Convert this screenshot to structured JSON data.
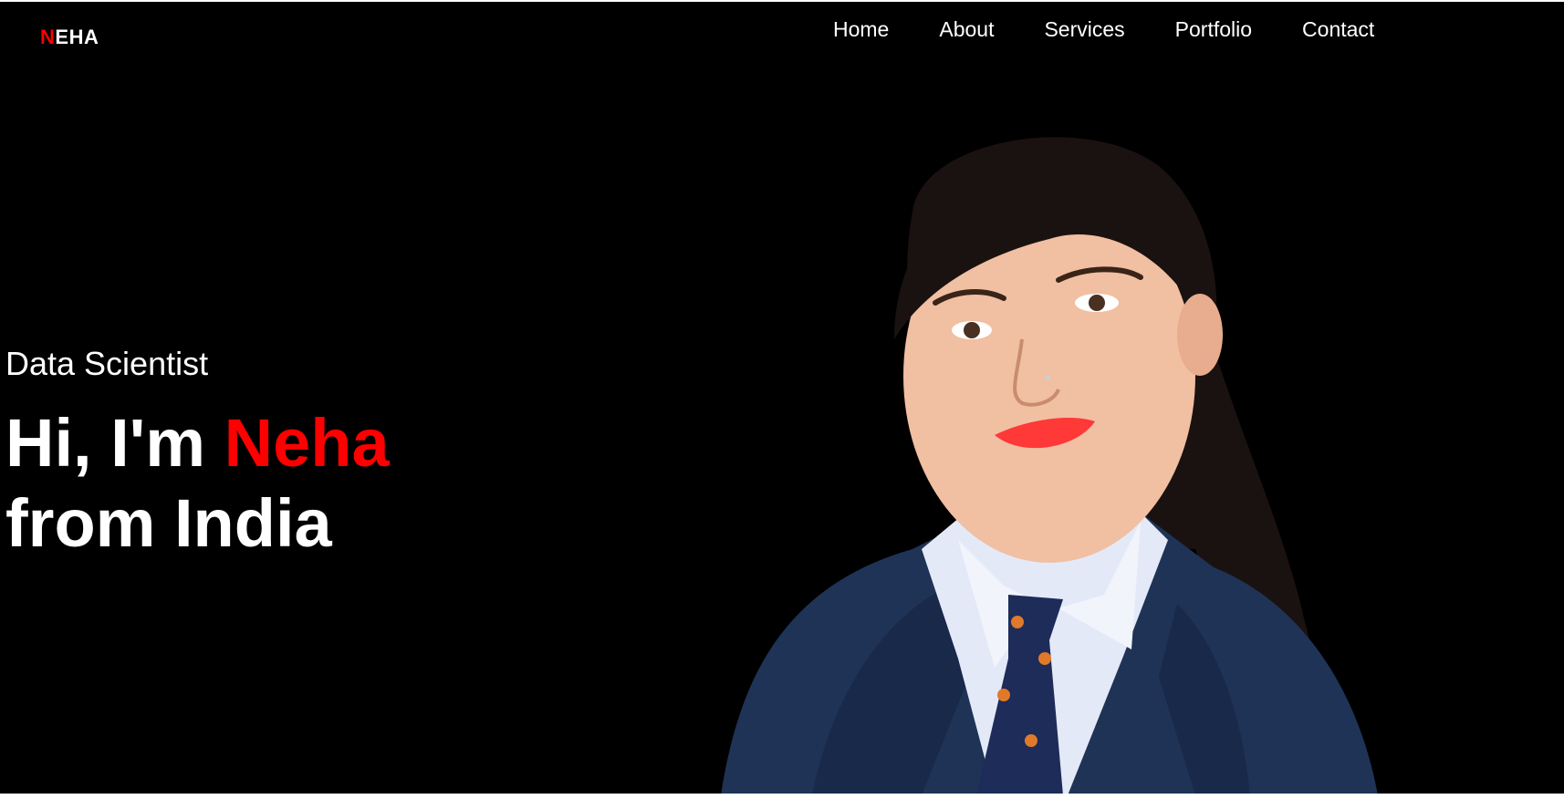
{
  "logo": {
    "first_letter": "N",
    "rest": "EHA"
  },
  "nav": {
    "items": [
      {
        "label": "Home"
      },
      {
        "label": "About"
      },
      {
        "label": "Services"
      },
      {
        "label": "Portfolio"
      },
      {
        "label": "Contact"
      }
    ]
  },
  "hero": {
    "subtitle": "Data Scientist",
    "greeting": "Hi, I'm ",
    "name": "Neha",
    "line2": "from India"
  },
  "colors": {
    "background": "#000000",
    "accent": "#ff0000",
    "text": "#ffffff"
  },
  "portrait": {
    "icon": "person-portrait-photo"
  }
}
